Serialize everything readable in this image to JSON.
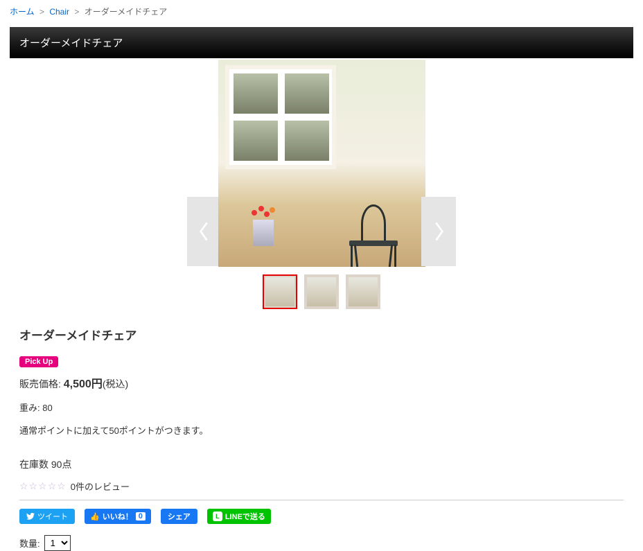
{
  "breadcrumb": {
    "home": "ホーム",
    "category": "Chair",
    "current": "オーダーメイドチェア"
  },
  "title_bar": "オーダーメイドチェア",
  "product": {
    "name": "オーダーメイドチェア",
    "pickup_label": "Pick Up",
    "price_label": "販売価格:",
    "price_value": "4,500円",
    "price_tax": "(税込)",
    "weight_label": "重み:",
    "weight_value": "80",
    "points_text": "通常ポイントに加えて50ポイントがつきます。",
    "stock_label": "在庫数",
    "stock_value": "90点",
    "review_count": "0件のレビュー"
  },
  "share": {
    "tweet": "ツイート",
    "like": "いいね！",
    "like_count": "0",
    "share": "シェア",
    "line": "LINEで送る"
  },
  "qty": {
    "label": "数量:",
    "value": "1"
  }
}
